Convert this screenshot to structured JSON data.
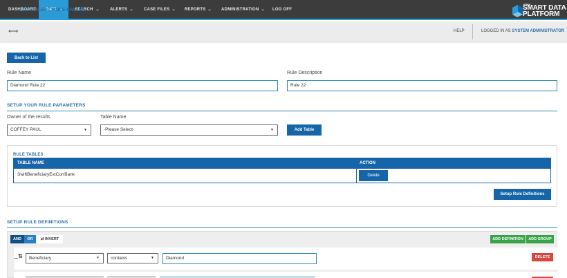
{
  "nav": {
    "items": [
      {
        "label": "DASHBOARD",
        "chevron": false,
        "active": false
      },
      {
        "label": "DATA",
        "chevron": true,
        "active": true
      },
      {
        "label": "SEARCH",
        "chevron": true,
        "active": false
      },
      {
        "label": "ALERTS",
        "chevron": true,
        "active": false
      },
      {
        "label": "CASE FILES",
        "chevron": true,
        "active": false
      },
      {
        "label": "REPORTS",
        "chevron": true,
        "active": false
      },
      {
        "label": "ADMINISTRATION",
        "chevron": true,
        "active": false
      },
      {
        "label": "LOG OFF",
        "chevron": false,
        "active": false
      }
    ],
    "logo_small": "WWA",
    "logo_line1": "SMART DATA",
    "logo_line2": "PLATFORM"
  },
  "breadcrumb": {
    "parent": "DATA",
    "separator": "/",
    "current": "ALERT RULE ENGINE"
  },
  "header_right": {
    "help": "HELP",
    "logged_prefix": "LOGGED IN AS",
    "user": "SYSTEM ADMINISTRATOR"
  },
  "back_button": "Back to List",
  "rule_name": {
    "label": "Rule Name",
    "value": "Diamond Rule 22"
  },
  "rule_description": {
    "label": "Rule Description",
    "value": "Rule 22"
  },
  "params_section": "SETUP YOUR RULE PARAMETERS",
  "owner": {
    "label": "Owner of the results",
    "value": "COFFEY PAUL"
  },
  "table_name": {
    "label": "Table Name",
    "value": "-Please Select-"
  },
  "add_table_button": "Add Table",
  "rule_tables": {
    "title": "RULE TABLES",
    "col_table": "TABLE NAME",
    "col_action": "ACTION",
    "rows": [
      {
        "table": "SwiftBeneficiaryExtCorrBank",
        "action": "Delete"
      }
    ],
    "setup_button": "Setup Rule Definitions"
  },
  "definitions": {
    "section": "SETUP RULE DEFINITIONS",
    "and": "AND",
    "or": "OR",
    "invert": "INVERT",
    "add_definition": "ADD DEFINITION",
    "add_group": "ADD GROUP",
    "field": "Beneficiary",
    "operator": "contains",
    "value": "Diamond",
    "delete": "DELETE"
  },
  "colors": {
    "nav_bg": "#3c3c3c",
    "accent": "#2a9bd6",
    "primary": "#1565a8",
    "green": "#3aa34a",
    "danger": "#d9463f"
  }
}
